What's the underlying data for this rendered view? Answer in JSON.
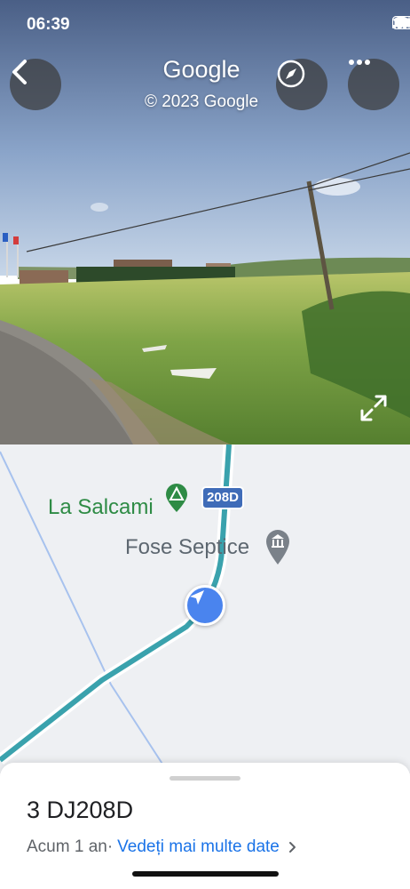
{
  "status_bar": {
    "time": "06:39"
  },
  "street_view": {
    "title": "Google",
    "copyright": "© 2023 Google",
    "buttons": {
      "back": "back-icon",
      "compass": "compass-icon",
      "more": "more-icon",
      "expand": "expand-icon"
    }
  },
  "map": {
    "pois": [
      {
        "name": "La Salcami",
        "icon": "campground-icon",
        "color": "#2e8b45"
      },
      {
        "name": "Fose Septice",
        "icon": "institution-icon",
        "color": "#7a8189"
      }
    ],
    "road_shield": "208D"
  },
  "sheet": {
    "title": "3 DJ208D",
    "date": "Acum 1 an",
    "separator": "·",
    "link": "Vedeți mai multe date",
    "link_color": "#1a73e8"
  }
}
